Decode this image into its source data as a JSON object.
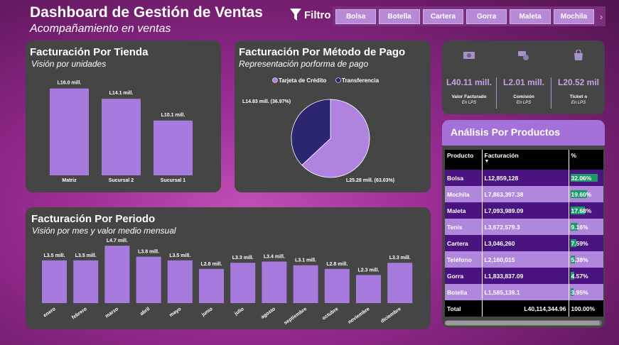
{
  "header": {
    "title": "Dashboard de Gestión de Ventas",
    "subtitle": "Acompañamiento en ventas",
    "filter_label": "Filtro",
    "slicer_items": [
      "Bolsa",
      "Botella",
      "Cartera",
      "Gorra",
      "Maleta",
      "Mochila"
    ],
    "slicer_next": "›"
  },
  "tienda": {
    "title": "Facturación Por Tienda",
    "subtitle": "Visión por unidades",
    "chart_data": {
      "type": "bar",
      "categories": [
        "Matriz",
        "Sucursal 2",
        "Sucursal 1"
      ],
      "values": [
        16.0,
        14.1,
        10.1
      ],
      "data_labels": [
        "L16.0 mill.",
        "L14.1 mill.",
        "L10.1 mill."
      ],
      "ylim": [
        0,
        17
      ]
    }
  },
  "metodo": {
    "title": "Facturación Por Método de Pago",
    "subtitle": "Representación porforma de pago",
    "chart_data": {
      "type": "pie",
      "categories": [
        "Tarjeta de Crédito",
        "Transferencia"
      ],
      "values": [
        25.28,
        14.83
      ],
      "percents": [
        63.03,
        36.97
      ],
      "data_labels": [
        "L25.28 mill. (63.03%)",
        "L14.83 mill. (36.97%)"
      ],
      "colors": [
        "#b083e0",
        "#2a2770"
      ],
      "legend_position": "top"
    }
  },
  "periodo": {
    "title": "Facturación Por Periodo",
    "subtitle": "Visión por mes y valor medio mensual",
    "chart_data": {
      "type": "bar",
      "categories": [
        "enero",
        "febrero",
        "marzo",
        "abril",
        "mayo",
        "junio",
        "julio",
        "agosto",
        "septiembre",
        "octubre",
        "noviembre",
        "diciembre"
      ],
      "values": [
        3.5,
        3.5,
        4.7,
        3.8,
        3.5,
        2.8,
        3.3,
        3.4,
        3.1,
        2.8,
        2.3,
        3.3
      ],
      "data_labels": [
        "L3.5 mill.",
        "L3.5 mill.",
        "L4.7 mill.",
        "L3.8 mill.",
        "L3.5 mill.",
        "L2.8 mill.",
        "L3.3 mill.",
        "L3.4 mill.",
        "L3.1 mill.",
        "L2.8 mill.",
        "L2.3 mill.",
        "L3.3 mill."
      ],
      "ylim": [
        0,
        5
      ]
    }
  },
  "kpis": [
    {
      "value": "L40.11 mill.",
      "label": "Valor Facturado",
      "unit": "En LPS",
      "icon": "money-icon"
    },
    {
      "value": "L2.01 mill.",
      "label": "Comisión",
      "unit": "En LPS",
      "icon": "coins-icon"
    },
    {
      "value": "L20.52 mil",
      "label": "Ticket o",
      "unit": "En LPS",
      "icon": "shopping-bag-icon"
    }
  ],
  "productos": {
    "title": "Análisis Por Productos",
    "columns": [
      "Producto",
      "Facturación",
      "%"
    ],
    "sort_icon": "▼",
    "rows": [
      {
        "producto": "Bolsa",
        "facturacion": "L12,859,128",
        "pct": "32.06%",
        "pct_value": 32.06
      },
      {
        "producto": "Mochila",
        "facturacion": "L7,863,397.38",
        "pct": "19.60%",
        "pct_value": 19.6
      },
      {
        "producto": "Maleta",
        "facturacion": "L7,093,989.09",
        "pct": "17.68%",
        "pct_value": 17.68
      },
      {
        "producto": "Tenis",
        "facturacion": "L3,672,579.3",
        "pct": "9.16%",
        "pct_value": 9.16
      },
      {
        "producto": "Cartera",
        "facturacion": "L3,046,260",
        "pct": "7.59%",
        "pct_value": 7.59
      },
      {
        "producto": "Teléfono",
        "facturacion": "L2,160,015",
        "pct": "5.38%",
        "pct_value": 5.38
      },
      {
        "producto": "Gorra",
        "facturacion": "L1,833,837.09",
        "pct": "4.57%",
        "pct_value": 4.57
      },
      {
        "producto": "Botella",
        "facturacion": "L1,585,139.1",
        "pct": "3.95%",
        "pct_value": 3.95
      }
    ],
    "total": {
      "label": "Total",
      "facturacion": "L40,114,344.96",
      "pct": "100.00%"
    }
  }
}
